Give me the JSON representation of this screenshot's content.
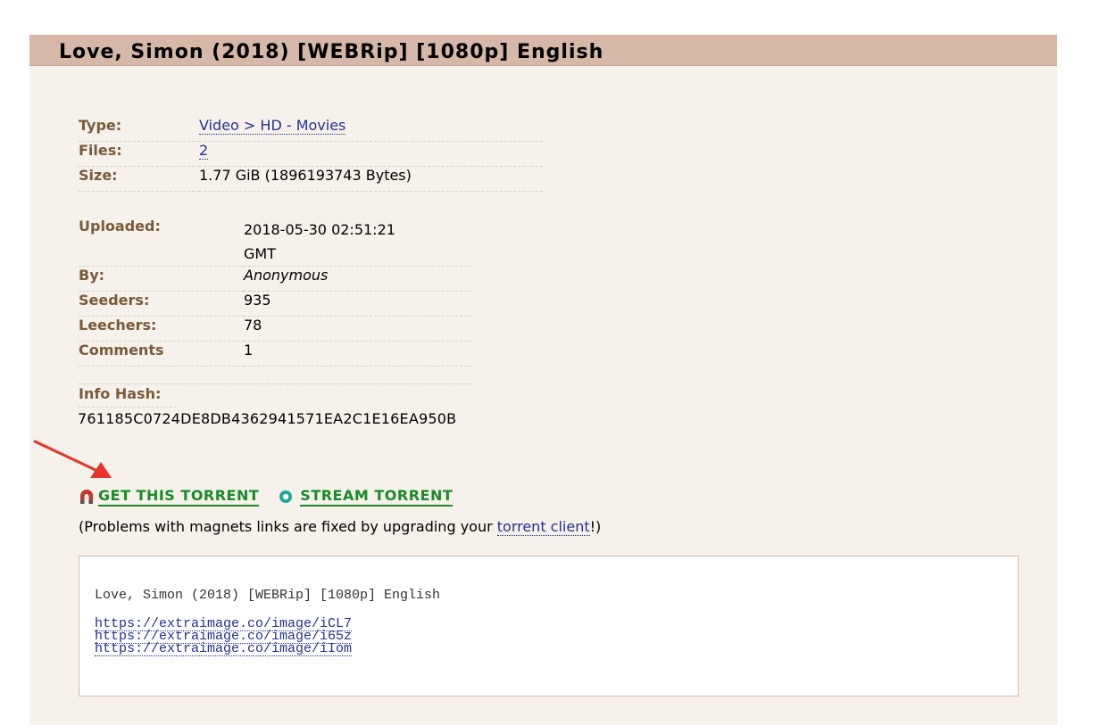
{
  "torrent": {
    "title": "Love, Simon (2018) [WEBRip] [1080p] English"
  },
  "details_left": [
    {
      "label": "Type:",
      "value": "Video > HD - Movies",
      "is_link": true
    },
    {
      "label": "Files:",
      "value": "2",
      "is_link": true
    },
    {
      "label": "Size:",
      "value": "1.77 GiB (1896193743 Bytes)",
      "is_link": false
    }
  ],
  "details_right": {
    "uploaded_label": "Uploaded:",
    "uploaded_value_line1": "2018-05-30 02:51:21",
    "uploaded_value_line2": "GMT",
    "by_label": "By:",
    "by_value": "Anonymous",
    "seeders_label": "Seeders:",
    "seeders_value": "935",
    "leechers_label": "Leechers:",
    "leechers_value": "78",
    "comments_label": "Comments",
    "comments_value": "1"
  },
  "info_hash": {
    "label": "Info Hash:",
    "value": "761185C0724DE8DB4362941571EA2C1E16EA950B"
  },
  "downloads": {
    "get_torrent_label": "GET THIS TORRENT",
    "stream_torrent_label": "STREAM TORRENT"
  },
  "problems": {
    "prefix": "(Problems with magnets links are fixed by upgrading your ",
    "link_text": "torrent client",
    "suffix": "!)"
  },
  "description": {
    "title": "Love, Simon (2018) [WEBRip] [1080p] English",
    "links": [
      "https://extraimage.co/image/iCL7",
      "https://extraimage.co/image/i65z",
      "https://extraimage.co/image/iIom"
    ]
  },
  "colors": {
    "title_bar": "#d5b8a8",
    "panel_bg": "#f6f1ea",
    "label_brown": "#7a5a3a",
    "download_green": "#1a8a2a",
    "link_blue": "#24308f",
    "arrow_red": "#e8342a"
  }
}
